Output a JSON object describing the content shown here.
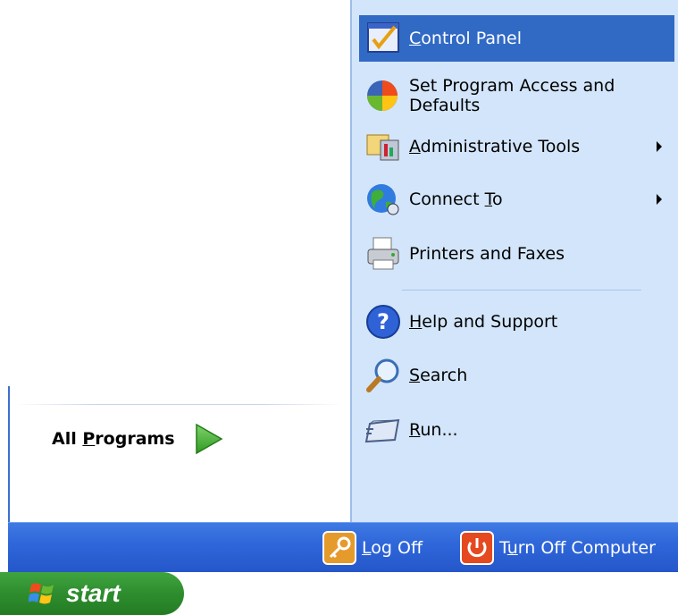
{
  "left": {
    "all_programs_pre": "All ",
    "all_programs_u": "P",
    "all_programs_post": "rograms"
  },
  "right_items": [
    {
      "pre": "",
      "u": "C",
      "post": "ontrol Panel",
      "icon": "control-panel-icon",
      "submenu": false,
      "selected": true
    },
    {
      "pre": "Set Program Access and",
      "u": "",
      "post": "",
      "line2": "Defaults",
      "icon": "program-access-icon",
      "submenu": false
    },
    {
      "pre": "",
      "u": "A",
      "post": "dministrative Tools",
      "icon": "administrative-tools-icon",
      "submenu": true
    },
    {
      "pre": "Connect ",
      "u": "T",
      "post": "o",
      "icon": "connect-globe-icon",
      "submenu": true
    },
    {
      "pre": "Printers and Faxes",
      "u": "",
      "post": "",
      "icon": "printer-icon",
      "submenu": false
    },
    {
      "pre": "",
      "u": "H",
      "post": "elp and Support",
      "icon": "help-icon",
      "submenu": false
    },
    {
      "pre": "",
      "u": "S",
      "post": "earch",
      "icon": "search-icon",
      "submenu": false
    },
    {
      "pre": "",
      "u": "R",
      "post": "un...",
      "icon": "run-icon",
      "submenu": false
    }
  ],
  "bottom": {
    "logoff_u": "L",
    "logoff_post": "og Off",
    "turnoff_pre": "T",
    "turnoff_u": "u",
    "turnoff_post": "rn Off Computer"
  },
  "taskbar": {
    "start_label": "start"
  },
  "colors": {
    "selected": "#316ac5",
    "right_pane": "#d3e5fa",
    "bar": "#2f67da",
    "start": "#2e8d2e"
  }
}
